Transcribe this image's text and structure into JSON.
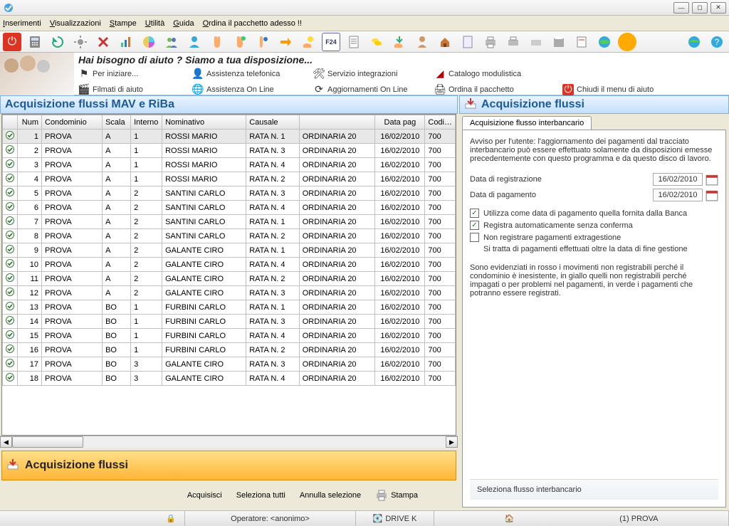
{
  "menu": {
    "inserimenti": "Inserimenti",
    "visualizzazioni": "Visualizzazioni",
    "stampe": "Stampe",
    "utilita": "Utilità",
    "guida": "Guida",
    "ordina": "Ordina il pacchetto adesso !!"
  },
  "help": {
    "title": "Hai bisogno di aiuto ?   Siamo a tua disposizione...",
    "per_iniziare": "Per iniziare...",
    "assistenza_tel": "Assistenza telefonica",
    "servizio_int": "Servizio integrazioni",
    "catalogo": "Catalogo modulistica",
    "filmati": "Filmati di aiuto",
    "assistenza_online": "Assistenza On Line",
    "aggiornamenti": "Aggiornamenti On Line",
    "ordina_pacchetto": "Ordina il pacchetto",
    "chiudi": "Chiudi il menu di aiuto"
  },
  "left_title": "Acquisizione flussi MAV e RiBa",
  "columns": {
    "check": "",
    "num": "Num",
    "condominio": "Condominio",
    "scala": "Scala",
    "interno": "Interno",
    "nominativo": "Nominativo",
    "causale": "Causale",
    "ordinaria": "",
    "data_pag": "Data pag",
    "codice": "Codi…"
  },
  "rows": [
    {
      "num": 1,
      "cond": "PROVA",
      "scala": "A",
      "int": "1",
      "nom": "ROSSI MARIO",
      "caus": "RATA N. 1",
      "ord": "ORDINARIA 20",
      "data": "16/02/2010",
      "cod": "700"
    },
    {
      "num": 2,
      "cond": "PROVA",
      "scala": "A",
      "int": "1",
      "nom": "ROSSI MARIO",
      "caus": "RATA N. 3",
      "ord": "ORDINARIA 20",
      "data": "16/02/2010",
      "cod": "700"
    },
    {
      "num": 3,
      "cond": "PROVA",
      "scala": "A",
      "int": "1",
      "nom": "ROSSI MARIO",
      "caus": "RATA N. 4",
      "ord": "ORDINARIA 20",
      "data": "16/02/2010",
      "cod": "700"
    },
    {
      "num": 4,
      "cond": "PROVA",
      "scala": "A",
      "int": "1",
      "nom": "ROSSI MARIO",
      "caus": "RATA N. 2",
      "ord": "ORDINARIA 20",
      "data": "16/02/2010",
      "cod": "700"
    },
    {
      "num": 5,
      "cond": "PROVA",
      "scala": "A",
      "int": "2",
      "nom": "SANTINI CARLO",
      "caus": "RATA N. 3",
      "ord": "ORDINARIA 20",
      "data": "16/02/2010",
      "cod": "700"
    },
    {
      "num": 6,
      "cond": "PROVA",
      "scala": "A",
      "int": "2",
      "nom": "SANTINI CARLO",
      "caus": "RATA N. 4",
      "ord": "ORDINARIA 20",
      "data": "16/02/2010",
      "cod": "700"
    },
    {
      "num": 7,
      "cond": "PROVA",
      "scala": "A",
      "int": "2",
      "nom": "SANTINI CARLO",
      "caus": "RATA N. 1",
      "ord": "ORDINARIA 20",
      "data": "16/02/2010",
      "cod": "700"
    },
    {
      "num": 8,
      "cond": "PROVA",
      "scala": "A",
      "int": "2",
      "nom": "SANTINI CARLO",
      "caus": "RATA N. 2",
      "ord": "ORDINARIA 20",
      "data": "16/02/2010",
      "cod": "700"
    },
    {
      "num": 9,
      "cond": "PROVA",
      "scala": "A",
      "int": "2",
      "nom": "GALANTE CIRO",
      "caus": "RATA N. 1",
      "ord": "ORDINARIA 20",
      "data": "16/02/2010",
      "cod": "700"
    },
    {
      "num": 10,
      "cond": "PROVA",
      "scala": "A",
      "int": "2",
      "nom": "GALANTE CIRO",
      "caus": "RATA N. 4",
      "ord": "ORDINARIA 20",
      "data": "16/02/2010",
      "cod": "700"
    },
    {
      "num": 11,
      "cond": "PROVA",
      "scala": "A",
      "int": "2",
      "nom": "GALANTE CIRO",
      "caus": "RATA N. 2",
      "ord": "ORDINARIA 20",
      "data": "16/02/2010",
      "cod": "700"
    },
    {
      "num": 12,
      "cond": "PROVA",
      "scala": "A",
      "int": "2",
      "nom": "GALANTE CIRO",
      "caus": "RATA N. 3",
      "ord": "ORDINARIA 20",
      "data": "16/02/2010",
      "cod": "700"
    },
    {
      "num": 13,
      "cond": "PROVA",
      "scala": "BO",
      "int": "1",
      "nom": "FURBINI CARLO",
      "caus": "RATA N. 1",
      "ord": "ORDINARIA 20",
      "data": "16/02/2010",
      "cod": "700"
    },
    {
      "num": 14,
      "cond": "PROVA",
      "scala": "BO",
      "int": "1",
      "nom": "FURBINI CARLO",
      "caus": "RATA N. 3",
      "ord": "ORDINARIA 20",
      "data": "16/02/2010",
      "cod": "700"
    },
    {
      "num": 15,
      "cond": "PROVA",
      "scala": "BO",
      "int": "1",
      "nom": "FURBINI CARLO",
      "caus": "RATA N. 4",
      "ord": "ORDINARIA 20",
      "data": "16/02/2010",
      "cod": "700"
    },
    {
      "num": 16,
      "cond": "PROVA",
      "scala": "BO",
      "int": "1",
      "nom": "FURBINI CARLO",
      "caus": "RATA N. 2",
      "ord": "ORDINARIA 20",
      "data": "16/02/2010",
      "cod": "700"
    },
    {
      "num": 17,
      "cond": "PROVA",
      "scala": "BO",
      "int": "3",
      "nom": "GALANTE CIRO",
      "caus": "RATA N. 3",
      "ord": "ORDINARIA 20",
      "data": "16/02/2010",
      "cod": "700"
    },
    {
      "num": 18,
      "cond": "PROVA",
      "scala": "BO",
      "int": "3",
      "nom": "GALANTE CIRO",
      "caus": "RATA N. 4",
      "ord": "ORDINARIA 20",
      "data": "16/02/2010",
      "cod": "700"
    }
  ],
  "orange_title": "Acquisizione flussi",
  "actions": {
    "acquisisci": "Acquisisci",
    "seleziona_tutti": "Seleziona tutti",
    "annulla_sel": "Annulla selezione",
    "stampa": "Stampa"
  },
  "right": {
    "title": "Acquisizione flussi",
    "tab": "Acquisizione flusso interbancario",
    "warning": "Avviso per l'utente: l'aggiornamento dei pagamenti dal tracciato interbancario può essere effettuato solamente da disposizioni emesse precedentemente con questo programma e da questo disco di lavoro.",
    "data_reg_label": "Data di registrazione",
    "data_pag_label": "Data di pagamento",
    "data_reg": "16/02/2010",
    "data_pag": "16/02/2010",
    "cb1": "Utilizza come data di pagamento quella fornita dalla Banca",
    "cb2": "Registra automaticamente senza conferma",
    "cb3": "Non registrare pagamenti extragestione",
    "cb3_note": "Si tratta di pagamenti effettuati oltre la data di fine gestione",
    "legend": "Sono evidenziati in rosso i movimenti non registrabili perché il condominio è inesistente, in giallo quelli non registrabili perché impagati o per problemi nel pagamenti, in verde i pagamenti che potranno essere registrati.",
    "footer": "Seleziona flusso interbancario"
  },
  "status": {
    "operatore": "Operatore: <anonimo>",
    "drive": "DRIVE K",
    "prova": "(1) PROVA"
  }
}
